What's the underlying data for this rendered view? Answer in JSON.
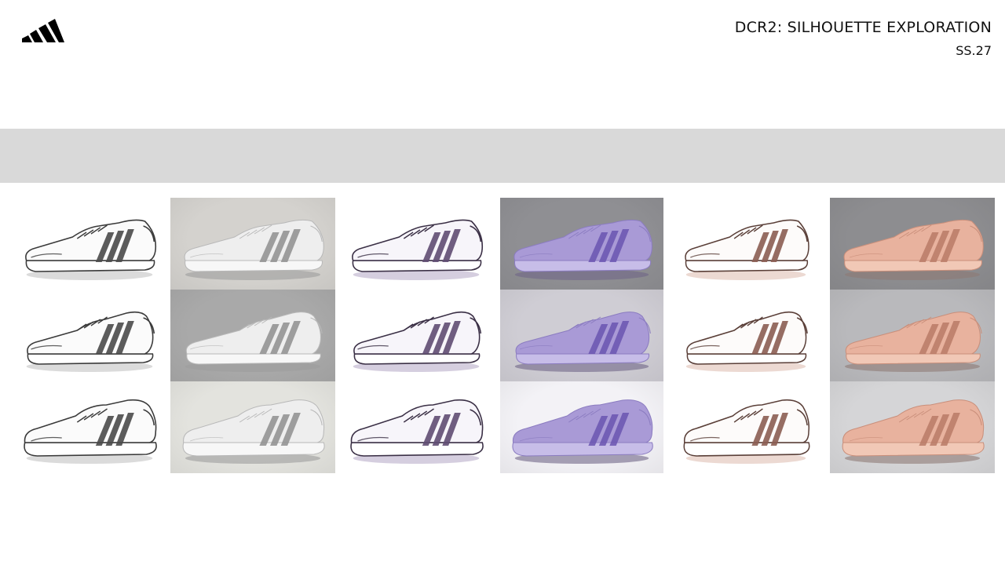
{
  "slide": {
    "title": "DCR2: SILHOUETTE EXPLORATION",
    "season": "SS.27"
  },
  "brand": {
    "logo_icon": "adidas-performance-logo",
    "logo_color": "#000000"
  },
  "band": {
    "color": "#d9d9d9"
  },
  "gallery": {
    "rows": 3,
    "columns": [
      {
        "style": "sketch",
        "tone": "neutral",
        "background": "#ffffff",
        "upper": "#fbfbfb",
        "line": "#3a3a3a",
        "stripe": "#4a4a4a",
        "shadow": "#bdbdbd",
        "sole": "#ffffff"
      },
      {
        "style": "render",
        "tone": "neutral",
        "backgrounds": [
          "#d4d2ce",
          "#a9a9a9",
          "#e3e3de"
        ],
        "upper": "#eeeeee",
        "line": "#b8b8b8",
        "stripe": "#8e8e8e",
        "shadow": "#9d9d9d",
        "sole": "#f7f7f7"
      },
      {
        "style": "sketch",
        "tone": "violet",
        "background": "#ffffff",
        "upper": "#f7f5fa",
        "line": "#3a2f45",
        "stripe": "#5f4d72",
        "shadow": "#b3a6c4",
        "sole": "#ffffff"
      },
      {
        "style": "render",
        "tone": "violet",
        "backgrounds": [
          "#8f8f93",
          "#cfcdd4",
          "#f3f2f6"
        ],
        "upper": "#a99ad6",
        "line": "#8b7cc0",
        "stripe": "#6a55b0",
        "shadow": "#6f6587",
        "sole": "#c7bde8"
      },
      {
        "style": "sketch",
        "tone": "peach",
        "background": "#ffffff",
        "upper": "#fdfbfa",
        "line": "#5a3f38",
        "stripe": "#8b5d52",
        "shadow": "#ddb9ad",
        "sole": "#ffffff"
      },
      {
        "style": "render",
        "tone": "peach",
        "backgrounds": [
          "#8d8d90",
          "#b9b9bc",
          "#d5d5d7"
        ],
        "upper": "#e8b29e",
        "line": "#c98f7b",
        "stripe": "#b97a66",
        "shadow": "#8e7a74",
        "sole": "#f1c8b6"
      }
    ]
  }
}
